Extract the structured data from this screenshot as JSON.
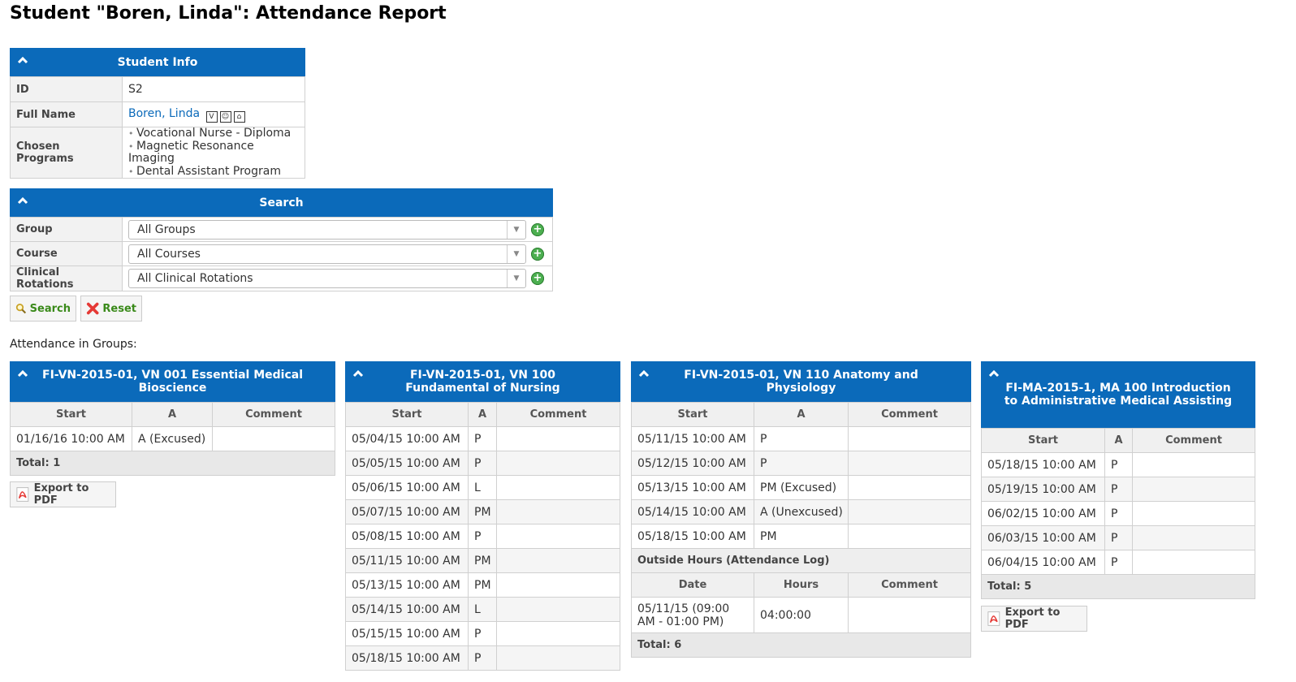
{
  "page": {
    "title": "Student \"Boren, Linda\": Attendance Report"
  },
  "student_info": {
    "header": "Student Info",
    "id_label": "ID",
    "id_value": "S2",
    "name_label": "Full Name",
    "name_value": "Boren, Linda",
    "programs_label": "Chosen Programs",
    "programs": [
      "Vocational Nurse - Diploma",
      "Magnetic Resonance Imaging",
      "Dental Assistant Program"
    ]
  },
  "search": {
    "header": "Search",
    "group_label": "Group",
    "group_value": "All Groups",
    "course_label": "Course",
    "course_value": "All Courses",
    "rotation_label": "Clinical Rotations",
    "rotation_value": "All Clinical Rotations",
    "search_button": "Search",
    "reset_button": "Reset"
  },
  "attendance_label": "Attendance in Groups:",
  "export_label": "Export to PDF",
  "columns": {
    "start": "Start",
    "a": "A",
    "comment": "Comment"
  },
  "groups": [
    {
      "title": "FI-VN-2015-01, VN 001 Essential Medical Bioscience",
      "rows": [
        {
          "start": "01/16/16 10:00 AM",
          "a": "A (Excused)",
          "comment": ""
        }
      ],
      "total": "Total: 1"
    },
    {
      "title": "FI-VN-2015-01, VN 100 Fundamental of Nursing",
      "rows": [
        {
          "start": "05/04/15 10:00 AM",
          "a": "P",
          "comment": ""
        },
        {
          "start": "05/05/15 10:00 AM",
          "a": "P",
          "comment": ""
        },
        {
          "start": "05/06/15 10:00 AM",
          "a": "L",
          "comment": ""
        },
        {
          "start": "05/07/15 10:00 AM",
          "a": "PM",
          "comment": ""
        },
        {
          "start": "05/08/15 10:00 AM",
          "a": "P",
          "comment": ""
        },
        {
          "start": "05/11/15 10:00 AM",
          "a": "PM",
          "comment": ""
        },
        {
          "start": "05/13/15 10:00 AM",
          "a": "PM",
          "comment": ""
        },
        {
          "start": "05/14/15 10:00 AM",
          "a": "L",
          "comment": ""
        },
        {
          "start": "05/15/15 10:00 AM",
          "a": "P",
          "comment": ""
        },
        {
          "start": "05/18/15 10:00 AM",
          "a": "P",
          "comment": ""
        }
      ]
    },
    {
      "title": "FI-VN-2015-01, VN 110 Anatomy and Physiology",
      "rows": [
        {
          "start": "05/11/15 10:00 AM",
          "a": "P",
          "comment": ""
        },
        {
          "start": "05/12/15 10:00 AM",
          "a": "P",
          "comment": ""
        },
        {
          "start": "05/13/15 10:00 AM",
          "a": "PM (Excused)",
          "comment": ""
        },
        {
          "start": "05/14/15 10:00 AM",
          "a": "A (Unexcused)",
          "comment": ""
        },
        {
          "start": "05/18/15 10:00 AM",
          "a": "PM",
          "comment": ""
        }
      ],
      "outside_label": "Outside Hours (Attendance Log)",
      "outside_columns": {
        "date": "Date",
        "hours": "Hours",
        "comment": "Comment"
      },
      "outside_rows": [
        {
          "date": "05/11/15 (09:00 AM - 01:00 PM)",
          "hours": "04:00:00",
          "comment": ""
        }
      ],
      "total": "Total: 6"
    },
    {
      "title": "FI-MA-2015-1, MA 100 Introduction to Administrative Medical Assisting",
      "rows": [
        {
          "start": "05/18/15 10:00 AM",
          "a": "P",
          "comment": ""
        },
        {
          "start": "05/19/15 10:00 AM",
          "a": "P",
          "comment": ""
        },
        {
          "start": "06/02/15 10:00 AM",
          "a": "P",
          "comment": ""
        },
        {
          "start": "06/03/15 10:00 AM",
          "a": "P",
          "comment": ""
        },
        {
          "start": "06/04/15 10:00 AM",
          "a": "P",
          "comment": ""
        }
      ],
      "total": "Total: 5"
    }
  ]
}
